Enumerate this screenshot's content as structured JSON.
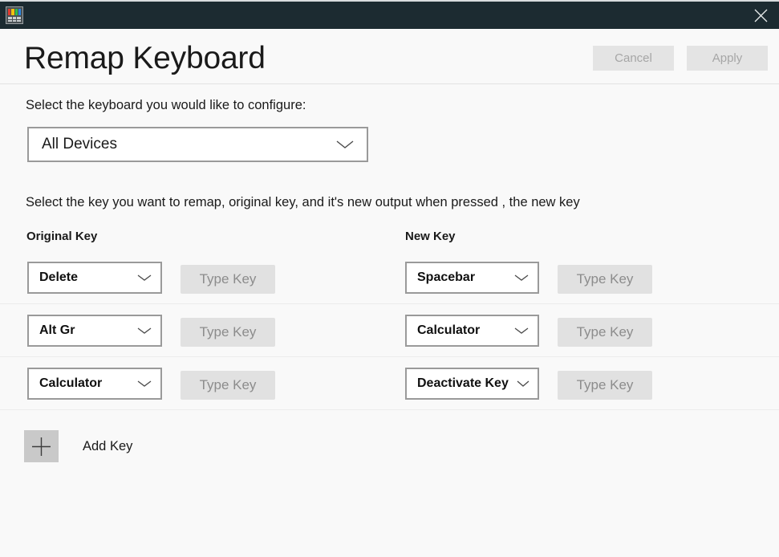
{
  "window": {
    "app_icon": "keyboard-app-icon",
    "close_icon": "close-icon"
  },
  "header": {
    "title": "Remap Keyboard",
    "cancel_label": "Cancel",
    "apply_label": "Apply"
  },
  "device": {
    "label": "Select the keyboard you would like to configure:",
    "selected": "All Devices",
    "chevron_icon": "chevron-down-icon"
  },
  "instructions": {
    "text": "Select the key you want to remap, original key, and it's new output when pressed , the new key"
  },
  "columns": {
    "original": "Original Key",
    "new": "New Key"
  },
  "type_key_label": "Type Key",
  "rows": [
    {
      "original": "Delete",
      "new": "Spacebar"
    },
    {
      "original": "Alt Gr",
      "new": "Calculator"
    },
    {
      "original": "Calculator",
      "new": "Deactivate Key"
    }
  ],
  "add_key": {
    "label": "Add Key",
    "icon": "plus-icon"
  },
  "colors": {
    "titlebar": "#1c2b31",
    "page_background": "#f9f9f9",
    "button_disabled": "#e4e4e4",
    "select_border": "#9a9a9a"
  }
}
